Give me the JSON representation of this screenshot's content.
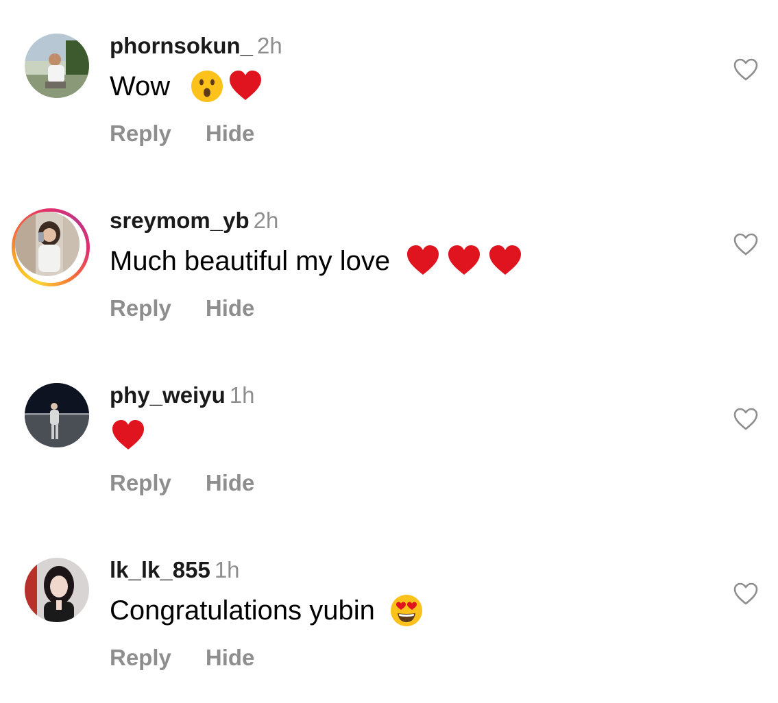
{
  "comments": [
    {
      "username": "phornsokun_",
      "time": "2h",
      "text": "Wow",
      "emojis": [
        "surprised-face",
        "red-heart"
      ],
      "reply_label": "Reply",
      "hide_label": "Hide"
    },
    {
      "username": "sreymom_yb",
      "time": "2h",
      "text": "Much beautiful my love",
      "emojis": [
        "red-heart",
        "red-heart",
        "red-heart"
      ],
      "reply_label": "Reply",
      "hide_label": "Hide"
    },
    {
      "username": "phy_weiyu",
      "time": "1h",
      "text": "",
      "emojis": [
        "red-heart"
      ],
      "reply_label": "Reply",
      "hide_label": "Hide"
    },
    {
      "username": "lk_lk_855",
      "time": "1h",
      "text": "Congratulations yubin",
      "emojis": [
        "heart-eyes-face"
      ],
      "reply_label": "Reply",
      "hide_label": "Hide"
    }
  ],
  "colors": {
    "username": "#1a1a1a",
    "secondary_text": "#8e8e8e",
    "heart_emoji": "#e0141e",
    "emoji_face": "#fcc21b"
  },
  "icons": {
    "like": "heart-outline-icon"
  }
}
